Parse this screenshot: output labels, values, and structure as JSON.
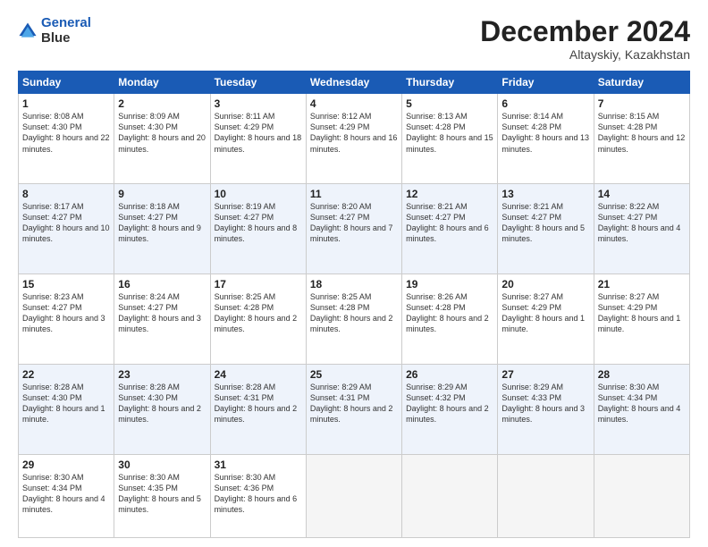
{
  "header": {
    "logo_line1": "General",
    "logo_line2": "Blue",
    "month": "December 2024",
    "location": "Altayskiy, Kazakhstan"
  },
  "weekdays": [
    "Sunday",
    "Monday",
    "Tuesday",
    "Wednesday",
    "Thursday",
    "Friday",
    "Saturday"
  ],
  "weeks": [
    [
      {
        "day": "1",
        "sunrise": "8:08 AM",
        "sunset": "4:30 PM",
        "daylight": "8 hours and 22 minutes."
      },
      {
        "day": "2",
        "sunrise": "8:09 AM",
        "sunset": "4:30 PM",
        "daylight": "8 hours and 20 minutes."
      },
      {
        "day": "3",
        "sunrise": "8:11 AM",
        "sunset": "4:29 PM",
        "daylight": "8 hours and 18 minutes."
      },
      {
        "day": "4",
        "sunrise": "8:12 AM",
        "sunset": "4:29 PM",
        "daylight": "8 hours and 16 minutes."
      },
      {
        "day": "5",
        "sunrise": "8:13 AM",
        "sunset": "4:28 PM",
        "daylight": "8 hours and 15 minutes."
      },
      {
        "day": "6",
        "sunrise": "8:14 AM",
        "sunset": "4:28 PM",
        "daylight": "8 hours and 13 minutes."
      },
      {
        "day": "7",
        "sunrise": "8:15 AM",
        "sunset": "4:28 PM",
        "daylight": "8 hours and 12 minutes."
      }
    ],
    [
      {
        "day": "8",
        "sunrise": "8:17 AM",
        "sunset": "4:27 PM",
        "daylight": "8 hours and 10 minutes."
      },
      {
        "day": "9",
        "sunrise": "8:18 AM",
        "sunset": "4:27 PM",
        "daylight": "8 hours and 9 minutes."
      },
      {
        "day": "10",
        "sunrise": "8:19 AM",
        "sunset": "4:27 PM",
        "daylight": "8 hours and 8 minutes."
      },
      {
        "day": "11",
        "sunrise": "8:20 AM",
        "sunset": "4:27 PM",
        "daylight": "8 hours and 7 minutes."
      },
      {
        "day": "12",
        "sunrise": "8:21 AM",
        "sunset": "4:27 PM",
        "daylight": "8 hours and 6 minutes."
      },
      {
        "day": "13",
        "sunrise": "8:21 AM",
        "sunset": "4:27 PM",
        "daylight": "8 hours and 5 minutes."
      },
      {
        "day": "14",
        "sunrise": "8:22 AM",
        "sunset": "4:27 PM",
        "daylight": "8 hours and 4 minutes."
      }
    ],
    [
      {
        "day": "15",
        "sunrise": "8:23 AM",
        "sunset": "4:27 PM",
        "daylight": "8 hours and 3 minutes."
      },
      {
        "day": "16",
        "sunrise": "8:24 AM",
        "sunset": "4:27 PM",
        "daylight": "8 hours and 3 minutes."
      },
      {
        "day": "17",
        "sunrise": "8:25 AM",
        "sunset": "4:28 PM",
        "daylight": "8 hours and 2 minutes."
      },
      {
        "day": "18",
        "sunrise": "8:25 AM",
        "sunset": "4:28 PM",
        "daylight": "8 hours and 2 minutes."
      },
      {
        "day": "19",
        "sunrise": "8:26 AM",
        "sunset": "4:28 PM",
        "daylight": "8 hours and 2 minutes."
      },
      {
        "day": "20",
        "sunrise": "8:27 AM",
        "sunset": "4:29 PM",
        "daylight": "8 hours and 1 minute."
      },
      {
        "day": "21",
        "sunrise": "8:27 AM",
        "sunset": "4:29 PM",
        "daylight": "8 hours and 1 minute."
      }
    ],
    [
      {
        "day": "22",
        "sunrise": "8:28 AM",
        "sunset": "4:30 PM",
        "daylight": "8 hours and 1 minute."
      },
      {
        "day": "23",
        "sunrise": "8:28 AM",
        "sunset": "4:30 PM",
        "daylight": "8 hours and 2 minutes."
      },
      {
        "day": "24",
        "sunrise": "8:28 AM",
        "sunset": "4:31 PM",
        "daylight": "8 hours and 2 minutes."
      },
      {
        "day": "25",
        "sunrise": "8:29 AM",
        "sunset": "4:31 PM",
        "daylight": "8 hours and 2 minutes."
      },
      {
        "day": "26",
        "sunrise": "8:29 AM",
        "sunset": "4:32 PM",
        "daylight": "8 hours and 2 minutes."
      },
      {
        "day": "27",
        "sunrise": "8:29 AM",
        "sunset": "4:33 PM",
        "daylight": "8 hours and 3 minutes."
      },
      {
        "day": "28",
        "sunrise": "8:30 AM",
        "sunset": "4:34 PM",
        "daylight": "8 hours and 4 minutes."
      }
    ],
    [
      {
        "day": "29",
        "sunrise": "8:30 AM",
        "sunset": "4:34 PM",
        "daylight": "8 hours and 4 minutes."
      },
      {
        "day": "30",
        "sunrise": "8:30 AM",
        "sunset": "4:35 PM",
        "daylight": "8 hours and 5 minutes."
      },
      {
        "day": "31",
        "sunrise": "8:30 AM",
        "sunset": "4:36 PM",
        "daylight": "8 hours and 6 minutes."
      },
      null,
      null,
      null,
      null
    ]
  ]
}
